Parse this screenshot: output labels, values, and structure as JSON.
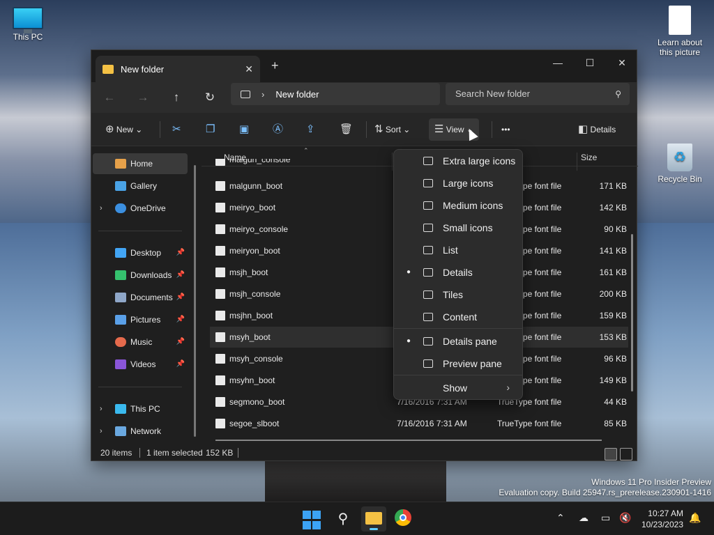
{
  "desktop": {
    "icons": [
      {
        "label": "This PC"
      },
      {
        "label": "Learn about this picture"
      },
      {
        "label": "Recycle Bin"
      }
    ],
    "watermark_line1": "Windows 11 Pro Insider Preview",
    "watermark_line2": "Evaluation copy. Build 25947.rs_prerelease.230901-1416"
  },
  "window": {
    "tab_title": "New folder",
    "new_tab": "+",
    "minimize": "—",
    "maximize": "☐",
    "close": "✕"
  },
  "nav": {
    "back": "←",
    "forward": "→",
    "up": "↑",
    "refresh": "↻",
    "breadcrumb": "New folder",
    "search_placeholder": "Search New folder"
  },
  "toolbar": {
    "new_label": "New",
    "sort_label": "Sort",
    "view_label": "View",
    "more": "•••",
    "details_label": "Details"
  },
  "sidebar": {
    "items": [
      {
        "label": "Home",
        "color": "#e6a14a"
      },
      {
        "label": "Gallery",
        "color": "#4aa3e6"
      },
      {
        "label": "OneDrive",
        "color": "#3b8fe0"
      },
      {
        "label": "Desktop",
        "color": "#42a5f5"
      },
      {
        "label": "Downloads",
        "color": "#35c16e"
      },
      {
        "label": "Documents",
        "color": "#8fa7c8"
      },
      {
        "label": "Pictures",
        "color": "#5aa0e8"
      },
      {
        "label": "Music",
        "color": "#e56a4c"
      },
      {
        "label": "Videos",
        "color": "#8a55d8"
      },
      {
        "label": "This PC",
        "color": "#3ab9ee"
      },
      {
        "label": "Network",
        "color": "#6aa8e0"
      }
    ]
  },
  "list": {
    "headers": {
      "name": "Name",
      "size": "Size"
    },
    "rows": [
      {
        "name": "malgun_console",
        "date": "",
        "type": "",
        "size": ""
      },
      {
        "name": "malgunn_boot",
        "date": "",
        "type": "TrueType font file",
        "size": "171 KB"
      },
      {
        "name": "meiryo_boot",
        "date": "",
        "type": "TrueType font file",
        "size": "142 KB"
      },
      {
        "name": "meiryo_console",
        "date": "",
        "type": "TrueType font file",
        "size": "90 KB"
      },
      {
        "name": "meiryon_boot",
        "date": "",
        "type": "TrueType font file",
        "size": "141 KB"
      },
      {
        "name": "msjh_boot",
        "date": "",
        "type": "TrueType font file",
        "size": "161 KB"
      },
      {
        "name": "msjh_console",
        "date": "",
        "type": "TrueType font file",
        "size": "200 KB"
      },
      {
        "name": "msjhn_boot",
        "date": "",
        "type": "TrueType font file",
        "size": "159 KB"
      },
      {
        "name": "msyh_boot",
        "date": "",
        "type": "TrueType font file",
        "size": "153 KB"
      },
      {
        "name": "msyh_console",
        "date": "",
        "type": "TrueType font file",
        "size": "96 KB"
      },
      {
        "name": "msyhn_boot",
        "date": "",
        "type": "TrueType font file",
        "size": "149 KB"
      },
      {
        "name": "segmono_boot",
        "date": "7/16/2016 7:31 AM",
        "type": "TrueType font file",
        "size": "44 KB"
      },
      {
        "name": "segoe_slboot",
        "date": "7/16/2016 7:31 AM",
        "type": "TrueType font file",
        "size": "85 KB"
      }
    ],
    "selected_index": 8
  },
  "view_menu": {
    "items": [
      {
        "label": "Extra large icons",
        "checked": false
      },
      {
        "label": "Large icons",
        "checked": false
      },
      {
        "label": "Medium icons",
        "checked": false
      },
      {
        "label": "Small icons",
        "checked": false
      },
      {
        "label": "List",
        "checked": false
      },
      {
        "label": "Details",
        "checked": true
      },
      {
        "label": "Tiles",
        "checked": false
      },
      {
        "label": "Content",
        "checked": false
      },
      {
        "label": "Details pane",
        "checked": true
      },
      {
        "label": "Preview pane",
        "checked": false
      },
      {
        "label": "Show",
        "checked": false
      }
    ],
    "bullet": "●",
    "submenu_arrow": "›"
  },
  "status": {
    "item_count": "20 items",
    "selected": "1 item selected",
    "selected_size": "152 KB"
  },
  "taskbar": {
    "time": "10:27 AM",
    "date": "10/23/2023",
    "accent": "#3ca3f5"
  }
}
